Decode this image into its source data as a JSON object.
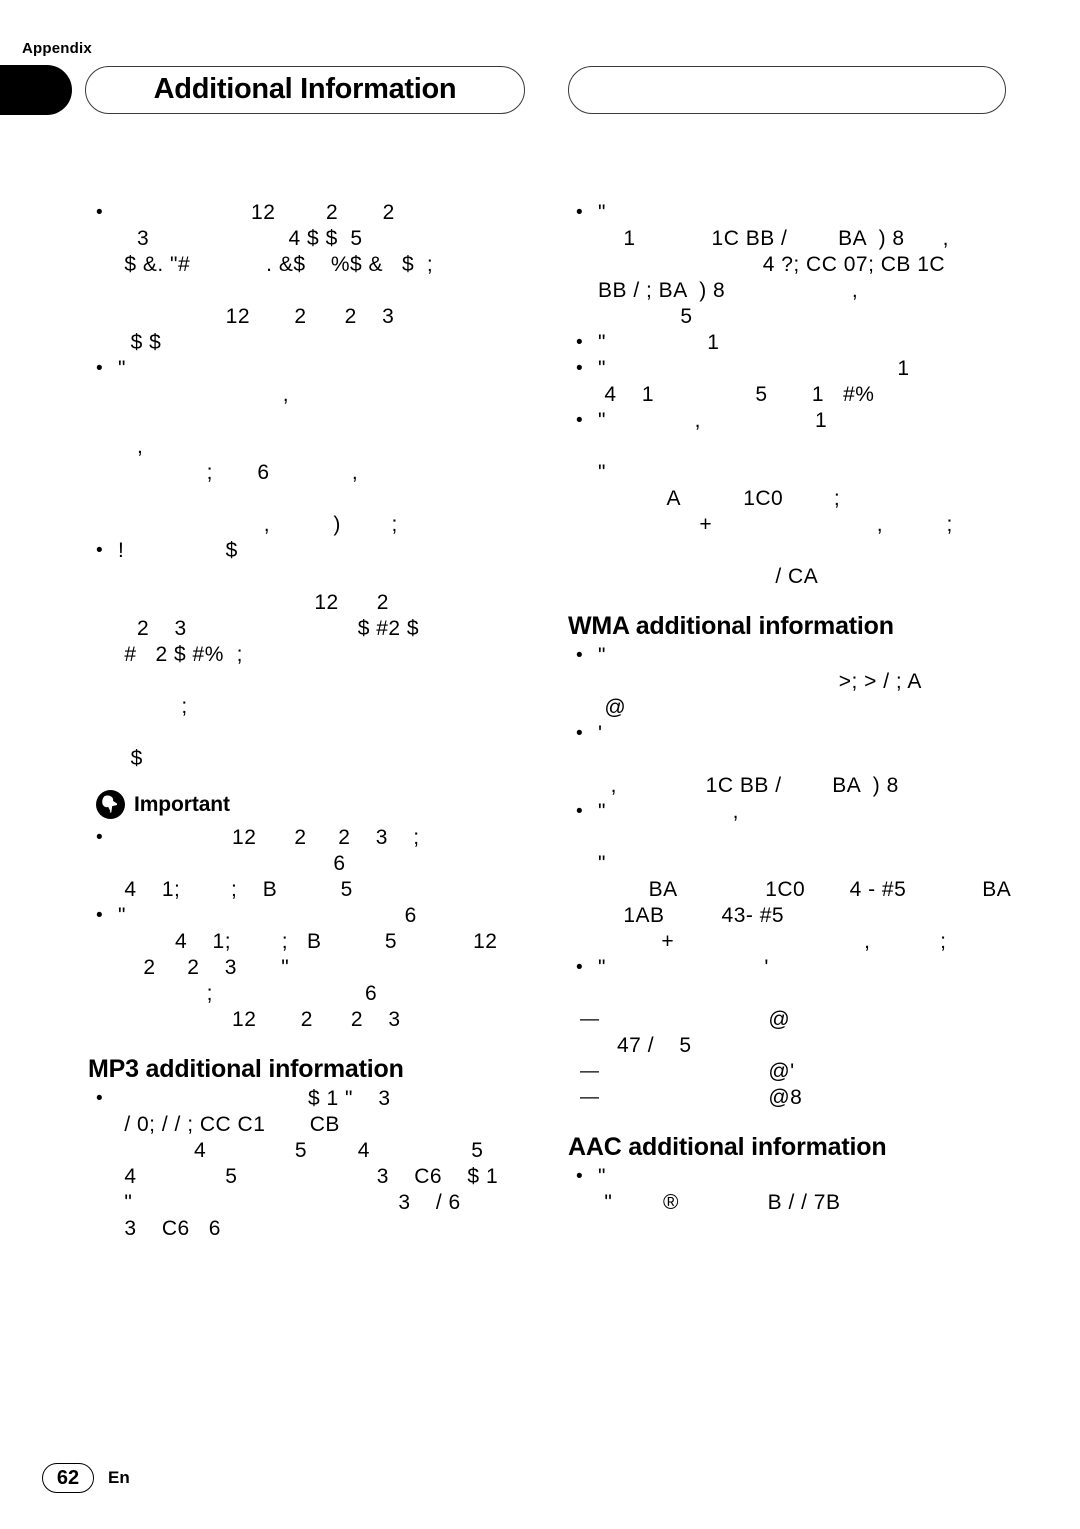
{
  "header": {
    "appendix_label": "Appendix",
    "title": "Additional Information",
    "right_pill_text": ""
  },
  "footer": {
    "page_number": "62",
    "language": "En"
  },
  "important": {
    "icon": "pushpin-icon",
    "label": "Important"
  },
  "headings": {
    "mp3": "MP3 additional information",
    "wma": "WMA additional information",
    "aac": "AAC additional information"
  },
  "left_column": {
    "blocks": [
      {
        "type": "bullet",
        "lines": [
          "                     12        2       2",
          "   3                      4 $ $  5",
          " $ &. \"#            . &$    %$ &   $  ;",
          "",
          "                 12       2      2    3",
          "  $ $"
        ]
      },
      {
        "type": "bullet",
        "lines": [
          "\"",
          "                          ,",
          "",
          "   ,",
          "              ;       6             ,",
          "",
          "                       ,          )        ;"
        ]
      },
      {
        "type": "bullet",
        "lines": [
          "!                $",
          "",
          "                               12      2",
          "   2    3                           $ #2 $",
          " #   2 $ #%  ;",
          "",
          "          ;",
          "",
          "  $"
        ]
      },
      {
        "type": "important"
      },
      {
        "type": "bullet",
        "lines": [
          "                  12      2     2    3    ;",
          "                                  6",
          " 4    1;        ;    B          5"
        ]
      },
      {
        "type": "bullet",
        "lines": [
          "\"                                            6",
          "         4    1;        ;   B          5            12",
          "    2     2    3       \"",
          "              ;                        6",
          "                  12       2      2    3"
        ]
      },
      {
        "type": "heading",
        "key": "mp3"
      },
      {
        "type": "bullet",
        "lines": [
          "                              $ 1 \"    3",
          " / 0; / / ; CC C1       CB",
          "            4              5        4                5",
          " 4              5                      3    C6    $ 1",
          " \"                                          3    / 6",
          " 3    C6   6"
        ]
      }
    ]
  },
  "right_column": {
    "blocks": [
      {
        "type": "bullet",
        "lines": [
          "\"",
          "    1            1C BB /        BA  ) 8      ,",
          "                          4 ?; CC 07; CB 1C",
          "BB / ; BA  ) 8                    ,",
          "             5"
        ]
      },
      {
        "type": "bullet",
        "lines": [
          "\"                1"
        ]
      },
      {
        "type": "bullet",
        "lines": [
          "\"                                              1",
          " 4    1                5       1   #%"
        ]
      },
      {
        "type": "bullet",
        "lines": [
          "\"              ,                  1",
          "",
          "\"",
          "           A          1C0        ;",
          "                +                          ,          ;",
          "",
          "                            / CA"
        ]
      },
      {
        "type": "heading",
        "key": "wma"
      },
      {
        "type": "bullet",
        "lines": [
          "\"",
          "                                      >; > / ; A",
          " @"
        ]
      },
      {
        "type": "bullet",
        "lines": [
          "'",
          "",
          "  ,              1C BB /        BA  ) 8"
        ]
      },
      {
        "type": "bullet",
        "lines": [
          "\"                    ,",
          "",
          "\"",
          "        BA              1C0       4 - #5            BA",
          "    1AB         43- #5",
          "          +                              ,           ;"
        ]
      },
      {
        "type": "bullet",
        "lines": [
          "\"                         '",
          ""
        ]
      },
      {
        "type": "dash",
        "lines": [
          "                         @",
          "   47 /    5"
        ]
      },
      {
        "type": "dash",
        "lines": [
          "                         @'"
        ]
      },
      {
        "type": "dash",
        "lines": [
          "                         @8"
        ]
      },
      {
        "type": "heading",
        "key": "aac"
      },
      {
        "type": "bullet",
        "lines": [
          "\"",
          " \"        ®              B / / 7B"
        ]
      }
    ]
  }
}
